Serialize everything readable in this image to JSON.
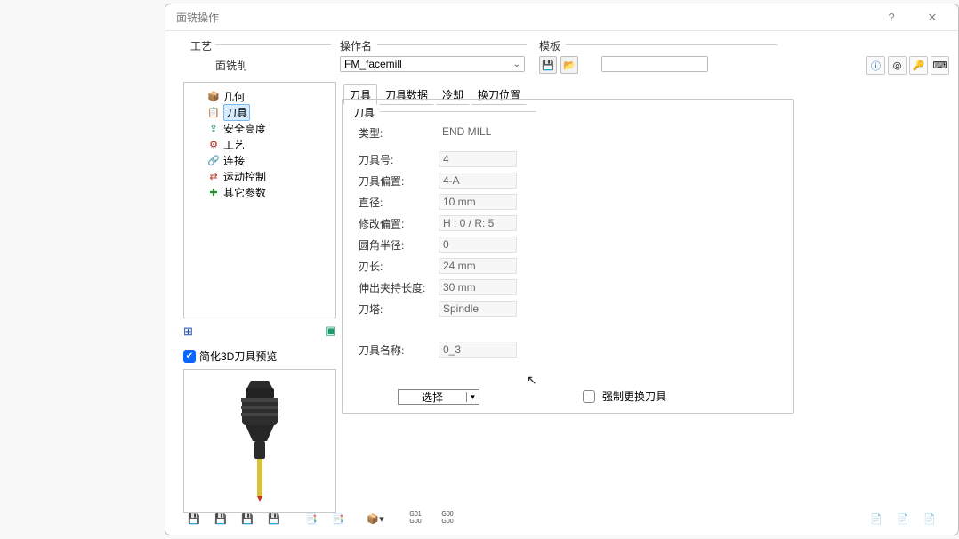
{
  "window": {
    "title": "面铣操作",
    "help": "?",
    "close": "✕"
  },
  "groups": {
    "tech": "工艺",
    "opname": "操作名",
    "template": "模板"
  },
  "tech_value": "面铣削",
  "opname_value": "FM_facemill",
  "tree": {
    "items": [
      {
        "icon": "📦",
        "label": "几何"
      },
      {
        "icon": "📋",
        "label": "刀具"
      },
      {
        "icon": "⇪",
        "label": "安全高度"
      },
      {
        "icon": "⚙",
        "label": "工艺"
      },
      {
        "icon": "🔗",
        "label": "连接"
      },
      {
        "icon": "⇄",
        "label": "运动控制"
      },
      {
        "icon": "✚",
        "label": "其它参数"
      }
    ]
  },
  "split_icon": "⊞",
  "chat_icon": "▣",
  "preview_label": "简化3D刀具预览",
  "tabs": [
    "刀具",
    "刀具数据",
    "冷却",
    "换刀位置"
  ],
  "form": {
    "group": "刀具",
    "rows": [
      {
        "label": "类型:",
        "value": "END MILL"
      },
      {
        "label": "刀具号:",
        "value": "4"
      },
      {
        "label": "刀具偏置:",
        "value": "4-A"
      },
      {
        "label": "直径:",
        "value": "10 mm"
      },
      {
        "label": "修改偏置:",
        "value": "H : 0 / R: 5"
      },
      {
        "label": "圆角半径:",
        "value": "0"
      },
      {
        "label": "刃长:",
        "value": "24 mm"
      },
      {
        "label": "伸出夹持长度:",
        "value": "30 mm"
      },
      {
        "label": "刀塔:",
        "value": "Spindle"
      },
      {
        "label": "刀具名称:",
        "value": "0_3"
      }
    ],
    "select": "选择",
    "force": "强制更换刀具"
  },
  "bottom_codes": {
    "a": "G01",
    "b": "G00",
    "c": "G00",
    "d": "G00"
  }
}
